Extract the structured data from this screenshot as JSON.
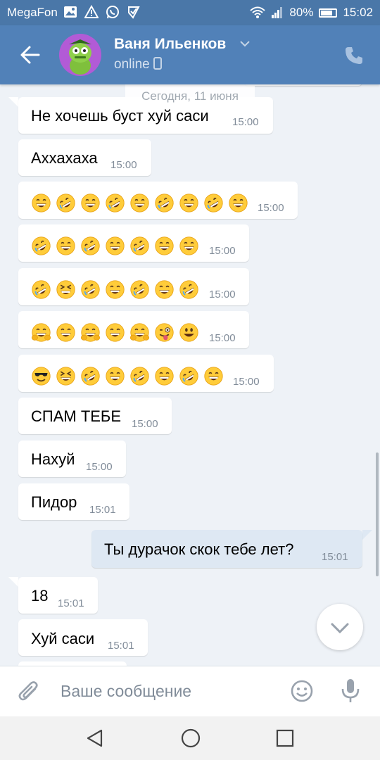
{
  "status_bar": {
    "carrier": "MegaFon",
    "battery": "80%",
    "time": "15:02",
    "icons": [
      "image-icon",
      "alert-icon",
      "whatsapp-icon",
      "check-icon",
      "wifi-icon",
      "signal-icon",
      "battery-icon"
    ]
  },
  "header": {
    "name": "Ваня Ильенков",
    "status": "online"
  },
  "chat": {
    "date_label": "Сегодня, 11 июня",
    "messages": [
      {
        "text": "Не хочешь буст хуй саси",
        "time": "15:00"
      },
      {
        "text": "Аххахаха",
        "time": "15:00"
      },
      {
        "emoji": [
          "grin",
          "rofl",
          "grin",
          "rofl",
          "grin",
          "rofl",
          "grin",
          "rofl",
          "grin"
        ],
        "time": "15:00"
      },
      {
        "emoji": [
          "rofl",
          "grin",
          "rofl",
          "grin",
          "rofl",
          "grin",
          "grin"
        ],
        "time": "15:00"
      },
      {
        "emoji": [
          "rofl",
          "squint",
          "rofl",
          "grin",
          "rofl",
          "grin",
          "rofl"
        ],
        "time": "15:00"
      },
      {
        "emoji": [
          "hug",
          "grin",
          "hug",
          "grin",
          "hug",
          "wink-tongue",
          "smile"
        ],
        "time": "15:00"
      },
      {
        "emoji": [
          "sunglasses",
          "squint",
          "rofl",
          "grin",
          "rofl",
          "grin",
          "rofl",
          "grin"
        ],
        "time": "15:00"
      },
      {
        "text": "СПАМ ТЕБЕ",
        "time": "15:00"
      },
      {
        "text": "Нахуй",
        "time": "15:00"
      },
      {
        "text": "Пидор",
        "time": "15:01"
      },
      {
        "text": "Ты дурачок скок тебе лет?",
        "time": "15:01",
        "outgoing": true
      },
      {
        "text": "18",
        "time": "15:01"
      },
      {
        "text": "Хуй саси",
        "time": "15:01"
      }
    ]
  },
  "input": {
    "placeholder": "Ваше сообщение"
  },
  "colors": {
    "header": "#5181b8",
    "status_bar": "#4a77a8",
    "chat_bg": "#eef2f7",
    "incoming_bubble": "#ffffff",
    "outgoing_bubble": "#dee8f3",
    "time_text": "#818c99"
  }
}
